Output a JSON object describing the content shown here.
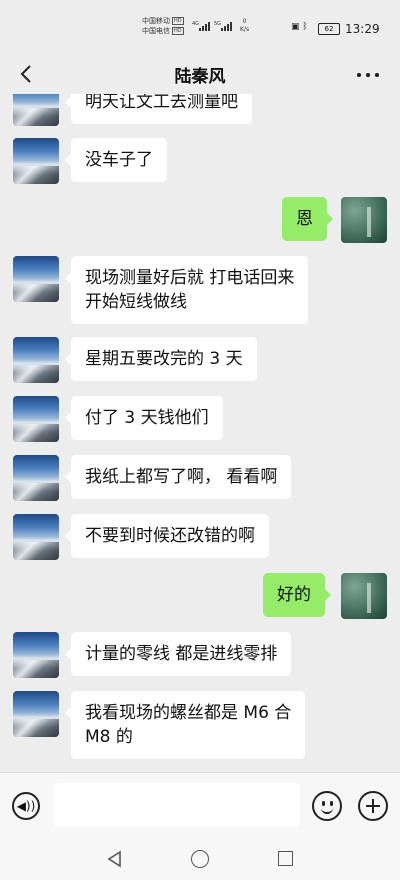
{
  "status_bar": {
    "carrier1": "中国移动",
    "carrier1_tag": "HD",
    "carrier2": "中国电信",
    "carrier2_tag": "HD",
    "signal1": "4G",
    "signal2": "5G",
    "net_speed_value": "0",
    "net_speed_unit": "K/s",
    "battery": "62",
    "time": "13:29"
  },
  "header": {
    "title": "陆秦风",
    "back_icon": "chevron-left-icon",
    "more_icon": "more-horizontal-icon"
  },
  "messages": [
    {
      "side": "left",
      "text": "明天让文工去测量吧"
    },
    {
      "side": "left",
      "text": "没车子了"
    },
    {
      "side": "right",
      "text": "恩"
    },
    {
      "side": "left",
      "text": "现场测量好后就 打电话回来",
      "text2": "开始短线做线"
    },
    {
      "side": "left",
      "text": "星期五要改完的 3 天"
    },
    {
      "side": "left",
      "text": "付了 3 天钱他们"
    },
    {
      "side": "left",
      "text": "我纸上都写了啊， 看看啊"
    },
    {
      "side": "left",
      "text": "不要到时候还改错的啊"
    },
    {
      "side": "right",
      "text": "好的"
    },
    {
      "side": "left",
      "text": "计量的零线 都是进线零排"
    },
    {
      "side": "left",
      "text": "我看现场的螺丝都是 M6 合",
      "text2": "M8 的"
    }
  ],
  "input_bar": {
    "placeholder": "",
    "voice_icon": "voice-icon",
    "emoji_icon": "emoji-icon",
    "plus_icon": "plus-icon"
  },
  "system_nav": {
    "back_icon": "triangle-back-icon",
    "home_icon": "circle-home-icon",
    "recent_icon": "square-recent-icon"
  }
}
